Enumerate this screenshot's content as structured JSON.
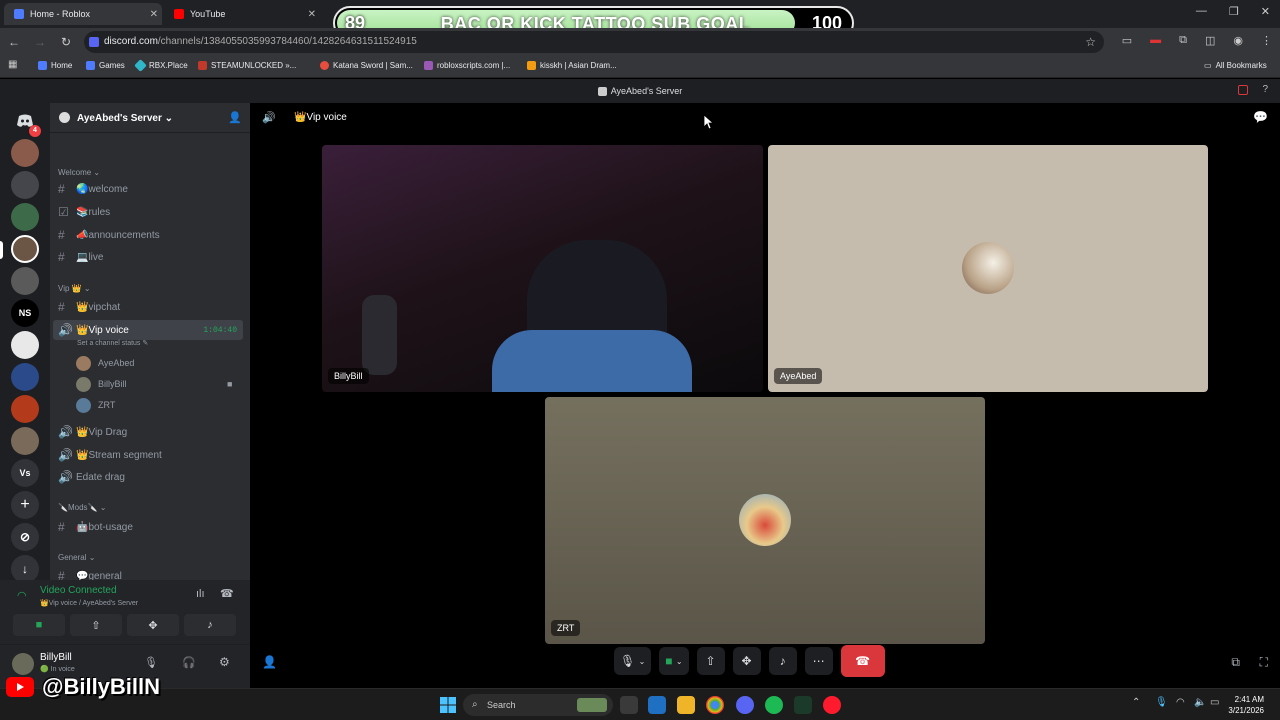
{
  "browser": {
    "tabs": [
      {
        "label": "Home - Roblox"
      },
      {
        "label": "YouTube"
      }
    ],
    "url_host": "discord.com",
    "url_path": "/channels/1384055035993784460/1428264631511524915",
    "bookmarks": [
      {
        "label": "Home"
      },
      {
        "label": "Games"
      },
      {
        "label": "RBX.Place"
      },
      {
        "label": "STEAMUNLOCKED »..."
      },
      {
        "label": "Katana Sword | Sam..."
      },
      {
        "label": "robloxscripts.com |..."
      },
      {
        "label": "kisskh | Asian Dram..."
      },
      {
        "label": "All Bookmarks"
      }
    ]
  },
  "overlay": {
    "current": "89",
    "title": "BAC OR KICK TATTOO SUB GOAL",
    "target": "100"
  },
  "discord": {
    "window_title": "AyeAbed's Server",
    "server_name": "AyeAbed's Server",
    "mention_badge": "4",
    "guild_ns": "NS",
    "guild_vs": "Vs",
    "categories": {
      "welcome": "Welcome",
      "vip": "Vip 👑",
      "mods": "🔪Mods🔪",
      "general": "General"
    },
    "channels": {
      "welcome": "🌏welcome",
      "rules": "📚rules",
      "announcements": "📣announcements",
      "live": "💻live",
      "vipchat": "👑vipchat",
      "vipvoice": "👑Vip voice",
      "vipdrag": "👑Vip Drag",
      "streamsegment": "👑Stream segment",
      "edatedrag": "Edate drag",
      "botusage": "🤖bot-usage",
      "general": "💬general"
    },
    "vip_voice_timer": "1:04:40",
    "channel_status": "Set a channel status",
    "members": [
      {
        "name": "AyeAbed"
      },
      {
        "name": "BillyBill"
      },
      {
        "name": "ZRT"
      }
    ],
    "voice_panel": {
      "status": "Video Connected",
      "location": "👑Vip voice / AyeAbed's Server"
    },
    "user_panel": {
      "name": "BillyBill",
      "status": "🟢 In voice"
    },
    "call": {
      "channel": "👑Vip voice",
      "tiles": [
        {
          "name": "BillyBill"
        },
        {
          "name": "AyeAbed"
        },
        {
          "name": "ZRT"
        }
      ]
    }
  },
  "taskbar": {
    "search_placeholder": "Search",
    "time": "2:41 AM",
    "date": "3/21/2026"
  },
  "watermark": {
    "handle": "@BillyBillN"
  }
}
